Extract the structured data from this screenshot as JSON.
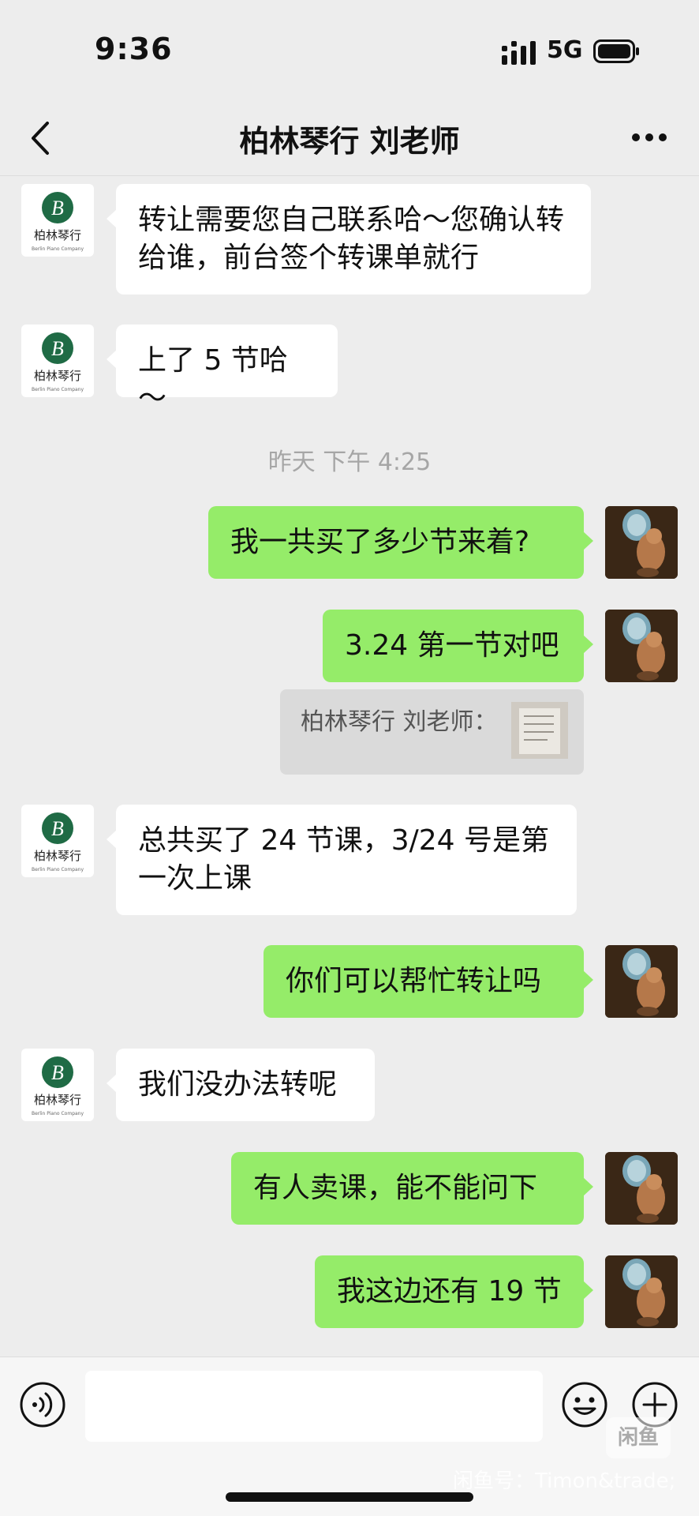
{
  "status_bar": {
    "time": "9:36",
    "network": "5G"
  },
  "nav": {
    "title": "柏林琴行 刘老师"
  },
  "contact": {
    "logo_text": "柏林琴行",
    "logo_subtext": "Berlin Piano Company",
    "logo_letter": "B"
  },
  "messages": [
    {
      "side": "left",
      "text": "转让需要您自己联系哈～您确认转给谁，前台签个转课单就行"
    },
    {
      "side": "left",
      "text": "上了 5 节哈～"
    },
    {
      "side": "right",
      "text": "我一共买了多少节来着?"
    },
    {
      "side": "right",
      "text": "3.24 第一节对吧"
    },
    {
      "side": "left",
      "text": "总共买了 24 节课，3/24 号是第一次上课"
    },
    {
      "side": "right",
      "text": "你们可以帮忙转让吗"
    },
    {
      "side": "left",
      "text": "我们没办法转呢"
    },
    {
      "side": "right",
      "text": "有人卖课，能不能问下"
    },
    {
      "side": "right",
      "text": "我这边还有 19 节"
    }
  ],
  "timestamp": "昨天 下午 4:25",
  "quote": {
    "label": "柏林琴行 刘老师："
  },
  "input": {
    "placeholder": ""
  },
  "watermark": {
    "badge": "闲鱼",
    "text": "闲鱼号：Timon&trade;"
  },
  "colors": {
    "background": "#ededed",
    "outgoing_bubble": "#95ec69",
    "incoming_bubble": "#ffffff",
    "logo_green": "#1f6b45"
  }
}
